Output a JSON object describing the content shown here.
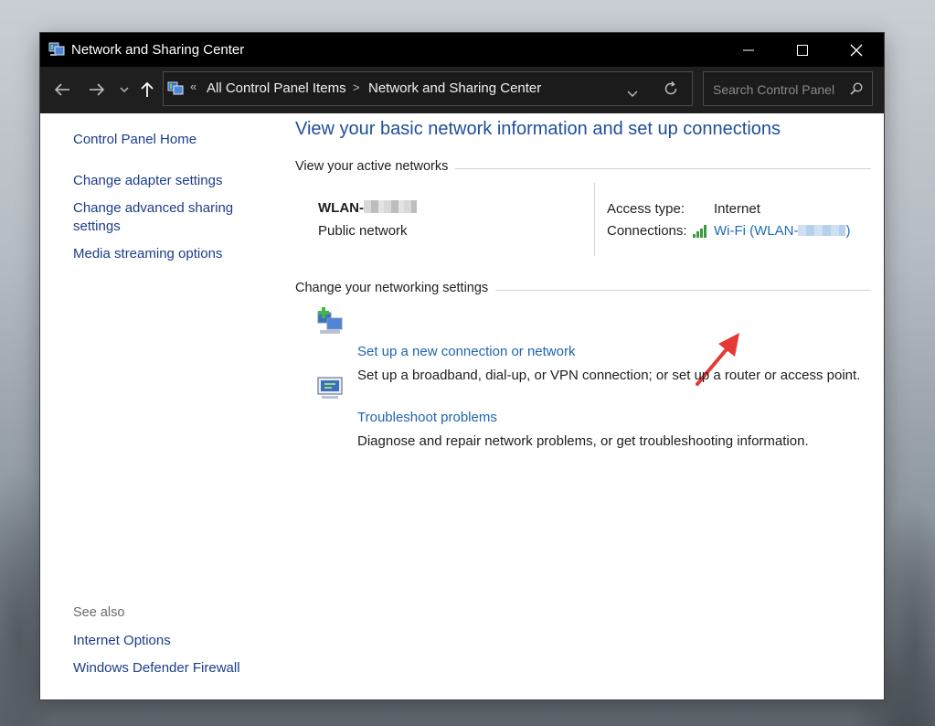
{
  "window": {
    "title": "Network and Sharing Center"
  },
  "address": {
    "overflow_marker": "«",
    "crumbs": [
      "All Control Panel Items",
      "Network and Sharing Center"
    ],
    "separator": ">"
  },
  "search": {
    "placeholder": "Search Control Panel"
  },
  "sidebar": {
    "home": "Control Panel Home",
    "links": [
      "Change adapter settings",
      "Change advanced sharing",
      "settings",
      "Media streaming options"
    ],
    "see_also_label": "See also",
    "see_also": [
      "Internet Options",
      "Windows Defender Firewall"
    ]
  },
  "main": {
    "heading": "View your basic network information and set up connections",
    "active_networks_label": "View your active networks",
    "network": {
      "name_prefix": "WLAN-",
      "category": "Public network",
      "access_type_label": "Access type:",
      "access_type_value": "Internet",
      "connections_label": "Connections:",
      "connection_link_prefix": "Wi-Fi (WLAN-",
      "connection_link_suffix": ")"
    },
    "change_settings_label": "Change your networking settings",
    "tasks": [
      {
        "title": "Set up a new connection or network",
        "desc": "Set up a broadband, dial-up, or VPN connection; or set up a router or access point."
      },
      {
        "title": "Troubleshoot problems",
        "desc": "Diagnose and repair network problems, or get troubleshooting information."
      }
    ]
  },
  "colors": {
    "link": "#1a3d8a",
    "heading": "#1f4e9c",
    "annotation_arrow": "#e53935"
  }
}
